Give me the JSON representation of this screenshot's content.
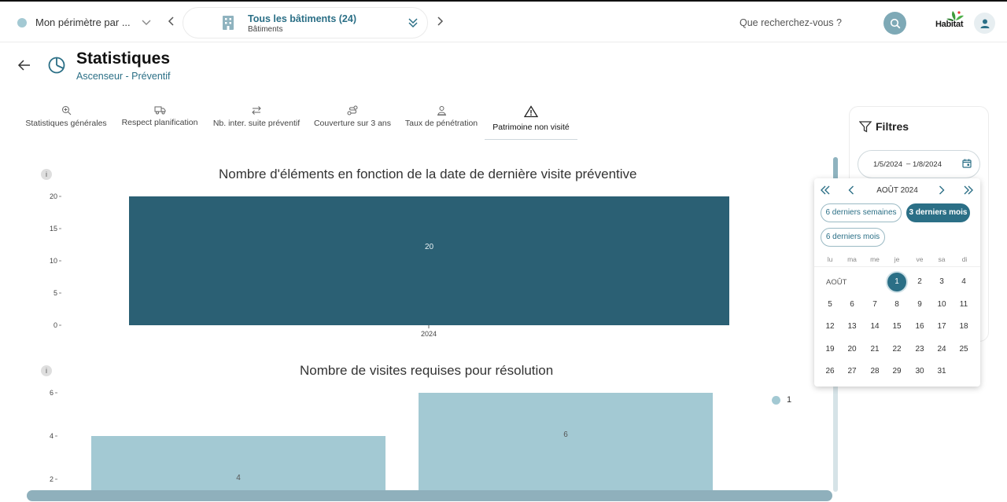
{
  "header": {
    "perimeter_label": "Mon périmètre par ...",
    "building_selector": {
      "title": "Tous les bâtiments (24)",
      "subtitle": "Bâtiments"
    },
    "search_placeholder": "Que recherchez-vous ?",
    "logo_text": "Habitat"
  },
  "page": {
    "title": "Statistiques",
    "subtitle": "Ascenseur - Préventif"
  },
  "tabs": [
    {
      "label": "Statistiques générales",
      "icon": "zoom-icon"
    },
    {
      "label": "Respect planification",
      "icon": "truck-icon"
    },
    {
      "label": "Nb. inter. suite préventif",
      "icon": "swap-icon"
    },
    {
      "label": "Couverture sur 3 ans",
      "icon": "route-icon"
    },
    {
      "label": "Taux de pénétration",
      "icon": "person-pin-icon"
    },
    {
      "label": "Patrimoine non visité",
      "icon": "warning-icon",
      "active": true
    }
  ],
  "charts": {
    "info_label": "i",
    "chart1": {
      "title": "Nombre d'éléments en fonction de la date de dernière visite préventive",
      "type": "bar",
      "categories": [
        "2024"
      ],
      "values": [
        20
      ],
      "data_labels": [
        "20"
      ],
      "yticks": [
        "0",
        "5",
        "10",
        "15",
        "20"
      ],
      "ylim": [
        0,
        20
      ],
      "color": "#2b6074"
    },
    "chart2": {
      "title": "Nombre de visites requises pour résolution",
      "type": "bar",
      "values": [
        4,
        6
      ],
      "data_labels": [
        "4",
        "6"
      ],
      "yticks": [
        "2",
        "4",
        "6"
      ],
      "ylim": [
        0,
        6
      ],
      "legend": "1",
      "color": "#a3c9d3"
    }
  },
  "chart_data": [
    {
      "type": "bar",
      "title": "Nombre d'éléments en fonction de la date de dernière visite préventive",
      "categories": [
        "2024"
      ],
      "values": [
        20
      ],
      "ylim": [
        0,
        20
      ],
      "xlabel": "",
      "ylabel": ""
    },
    {
      "type": "bar",
      "title": "Nombre de visites requises pour résolution",
      "series": [
        {
          "name": "1",
          "values": [
            4,
            6
          ]
        }
      ],
      "ylim": [
        0,
        6
      ],
      "xlabel": "",
      "ylabel": ""
    }
  ],
  "filters": {
    "title": "Filtres",
    "date_start": "1/5/2024",
    "date_separator": "–",
    "date_end": "1/8/2024"
  },
  "datepicker": {
    "month_title": "AOÛT 2024",
    "month_label": "AOÛT",
    "presets": [
      {
        "label": "6 derniers semaines",
        "active": false
      },
      {
        "label": "3 derniers mois",
        "active": true
      },
      {
        "label": "6 derniers mois",
        "active": false
      }
    ],
    "weekdays": [
      "lu",
      "ma",
      "me",
      "je",
      "ve",
      "sa",
      "di"
    ],
    "days": [
      "1",
      "2",
      "3",
      "4",
      "5",
      "6",
      "7",
      "8",
      "9",
      "10",
      "11",
      "12",
      "13",
      "14",
      "15",
      "16",
      "17",
      "18",
      "19",
      "20",
      "21",
      "22",
      "23",
      "24",
      "25",
      "26",
      "27",
      "28",
      "29",
      "30",
      "31"
    ],
    "selected_day": "1"
  }
}
